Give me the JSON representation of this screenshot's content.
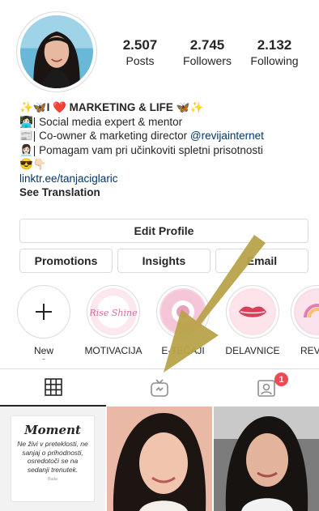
{
  "profile": {
    "stats": [
      {
        "num": "2.507",
        "label": "Posts"
      },
      {
        "num": "2.745",
        "label": "Followers"
      },
      {
        "num": "2.132",
        "label": "Following"
      }
    ]
  },
  "bio": {
    "headline": "✨🦋I ❤️ MARKETING & LIFE 🦋✨",
    "line1": "👩🏻‍💻| Social media expert & mentor",
    "line2_prefix": "📰| Co-owner & marketing director ",
    "line2_mention": "@revijainternet",
    "line3": "👩🏻‍💼| Pomagam vam pri učinkoviti spletni prisotnosti",
    "line4": "😎👇🏻",
    "link": "linktr.ee/tanjaciglaric",
    "translate": "See Translation"
  },
  "buttons": {
    "edit_profile": "Edit Profile",
    "promotions": "Promotions",
    "insights": "Insights",
    "email": "Email"
  },
  "highlights": [
    {
      "label": "New"
    },
    {
      "label": "MOTIVACIJA",
      "cover_text": "Rise Shine"
    },
    {
      "label": "E-TEČAJI"
    },
    {
      "label": "DELAVNICE"
    },
    {
      "label": "REVIJA"
    }
  ],
  "tabs": {
    "notification_count": "1"
  },
  "posts": {
    "quote_title": "Moment",
    "quote_text": "Ne živi v preteklosti, ne sanjaj o prihodnosti, osredotoči se na sedanji trenutek.",
    "quote_author": "Buda"
  },
  "colors": {
    "accent_red": "#ed4956",
    "link_blue": "#003569",
    "arrow": "#b8a24a",
    "highlight_pink": "#e8a0c0"
  }
}
